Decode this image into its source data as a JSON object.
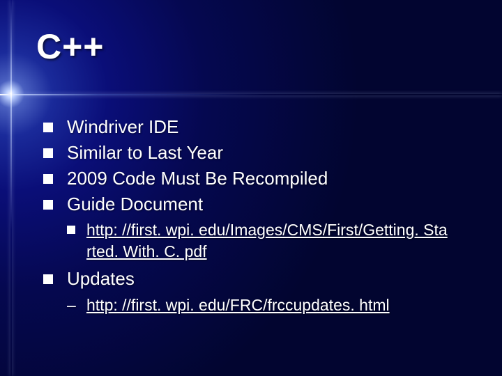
{
  "title": "C++",
  "bullets": {
    "b0": "Windriver IDE",
    "b1": "Similar to Last Year",
    "b2": "2009 Code Must Be Recompiled",
    "b3": "Guide Document",
    "b3_sub_line1": "http: //first. wpi. edu/Images/CMS/First/Getting. Sta",
    "b3_sub_line2": "rted. With. C. pdf",
    "b4": "Updates",
    "b4_sub": "http: //first. wpi. edu/FRC/frccupdates. html"
  }
}
